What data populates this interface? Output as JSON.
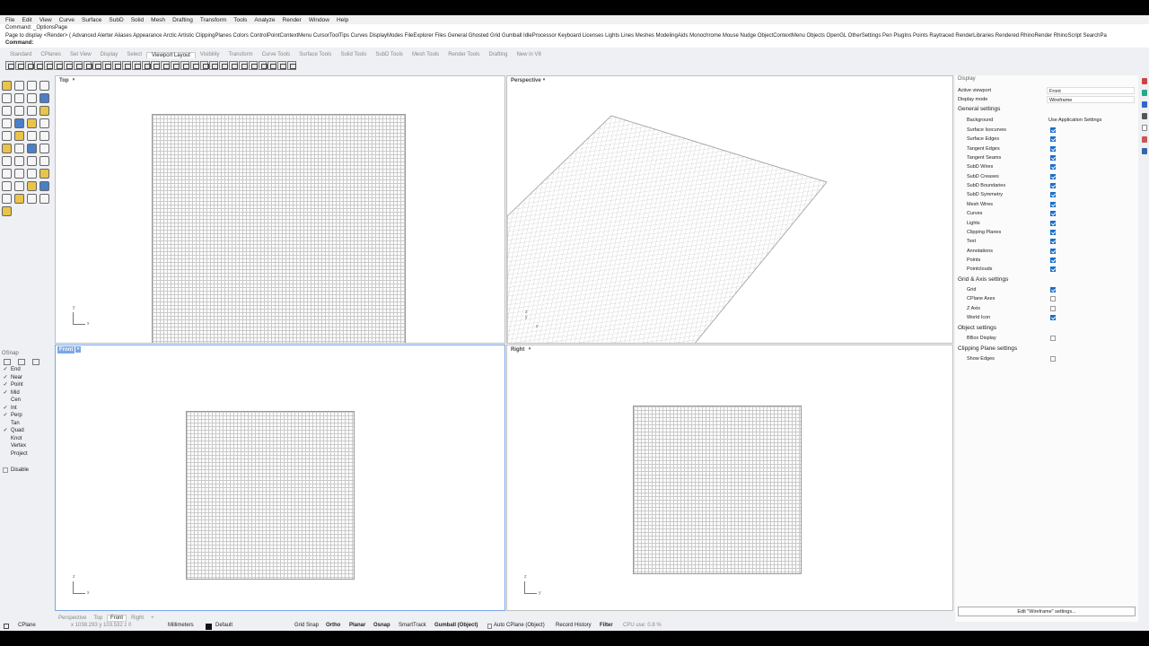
{
  "menu": [
    "File",
    "Edit",
    "View",
    "Curve",
    "Surface",
    "SubD",
    "Solid",
    "Mesh",
    "Drafting",
    "Transform",
    "Tools",
    "Analyze",
    "Render",
    "Window",
    "Help"
  ],
  "command_history": [
    "Command: _OptionsPage",
    "Page to display <Render> ( Advanced Alerter Aliases Appearance Arctic Artistic ClippingPlanes Colors ControlPointContextMenu CursorToolTips Curves DisplayModes FileExplorer Files General Ghosted Grid Gumball IdleProcessor Keyboard Licenses Lights Lines Meshes ModelingAids Monochrome Mouse Nudge ObjectContextMenu Objects OpenGL OtherSettings Pen PlugIns Points Raytraced RenderLibraries Rendered RhinoRender RhinoScript SearchPa"
  ],
  "command_prompt": "Command:",
  "toolbar_tabs": [
    "Standard",
    "CPlanes",
    "Set View",
    "Display",
    "Select",
    "Viewport Layout",
    "Visibility",
    "Transform",
    "Curve Tools",
    "Surface Tools",
    "Solid Tools",
    "SubD Tools",
    "Mesh Tools",
    "Render Tools",
    "Drafting",
    "New in V8"
  ],
  "active_toolbar_tab": "Viewport Layout",
  "osnap": {
    "title": "OSnap",
    "items": [
      {
        "label": "End",
        "checked": true
      },
      {
        "label": "Near",
        "checked": true
      },
      {
        "label": "Point",
        "checked": true
      },
      {
        "label": "Mid",
        "checked": true
      },
      {
        "label": "Cen",
        "checked": false
      },
      {
        "label": "Int",
        "checked": true
      },
      {
        "label": "Perp",
        "checked": true
      },
      {
        "label": "Tan",
        "checked": false
      },
      {
        "label": "Quad",
        "checked": true
      },
      {
        "label": "Knot",
        "checked": false
      },
      {
        "label": "Vertex",
        "checked": false
      },
      {
        "label": "Project",
        "checked": false
      }
    ],
    "disable_label": "Disable"
  },
  "viewports": {
    "top": {
      "title": "Top",
      "axis1": "y",
      "axis2": "x"
    },
    "perspective": {
      "title": "Perspective",
      "axis1": "z y",
      "axis2": "x"
    },
    "front": {
      "title": "Front",
      "axis1": "z",
      "axis2": "x"
    },
    "right": {
      "title": "Right",
      "axis1": "z",
      "axis2": "y"
    }
  },
  "viewport_tabs": [
    "Perspective",
    "Top",
    "Front",
    "Right"
  ],
  "active_viewport_tab": "Front",
  "display_panel": {
    "title": "Display",
    "active_viewport_label": "Active viewport",
    "active_viewport_value": "Front",
    "display_mode_label": "Display mode",
    "display_mode_value": "Wireframe",
    "general_settings_title": "General settings",
    "background_label": "Background",
    "background_value": "Use Application Settings",
    "general_items": [
      {
        "label": "Surface Isocurves",
        "checked": true
      },
      {
        "label": "Surface Edges",
        "checked": true
      },
      {
        "label": "Tangent Edges",
        "checked": true
      },
      {
        "label": "Tangent Seams",
        "checked": true
      },
      {
        "label": "SubD Wires",
        "checked": true
      },
      {
        "label": "SubD Creases",
        "checked": true
      },
      {
        "label": "SubD Boundaries",
        "checked": true
      },
      {
        "label": "SubD Symmetry",
        "checked": true
      },
      {
        "label": "Mesh Wires",
        "checked": true
      },
      {
        "label": "Curves",
        "checked": true
      },
      {
        "label": "Lights",
        "checked": true
      },
      {
        "label": "Clipping Planes",
        "checked": true
      },
      {
        "label": "Text",
        "checked": true
      },
      {
        "label": "Annotations",
        "checked": true
      },
      {
        "label": "Points",
        "checked": true
      },
      {
        "label": "Pointclouds",
        "checked": true
      }
    ],
    "grid_axis_title": "Grid & Axis settings",
    "grid_items": [
      {
        "label": "Grid",
        "checked": true
      },
      {
        "label": "CPlane Axes",
        "checked": false
      },
      {
        "label": "Z Axis",
        "checked": false
      },
      {
        "label": "World Icon",
        "checked": true
      }
    ],
    "object_settings_title": "Object settings",
    "object_items": [
      {
        "label": "BBox Display",
        "checked": false
      }
    ],
    "clipping_settings_title": "Clipping Plane settings",
    "clipping_items": [
      {
        "label": "Show Edges",
        "checked": false
      }
    ],
    "edit_button": "Edit \"Wireframe\" settings..."
  },
  "status": {
    "cplane": "CPlane",
    "coords": "x 1038.293  y 103.532  z 0",
    "units": "Millimeters",
    "layer": "Default",
    "grid_snap": "Grid Snap",
    "ortho": "Ortho",
    "planar": "Planar",
    "osnap": "Osnap",
    "smarttrack": "SmartTrack",
    "gumball": "Gumball (Object)",
    "auto_cplane": "Auto CPlane (Object)",
    "record_history": "Record History",
    "filter": "Filter",
    "cpu": "CPU use: 0.8 %"
  },
  "colors": {
    "accent": "#1e6fc8",
    "active_viewport": "#7aa7e6"
  }
}
